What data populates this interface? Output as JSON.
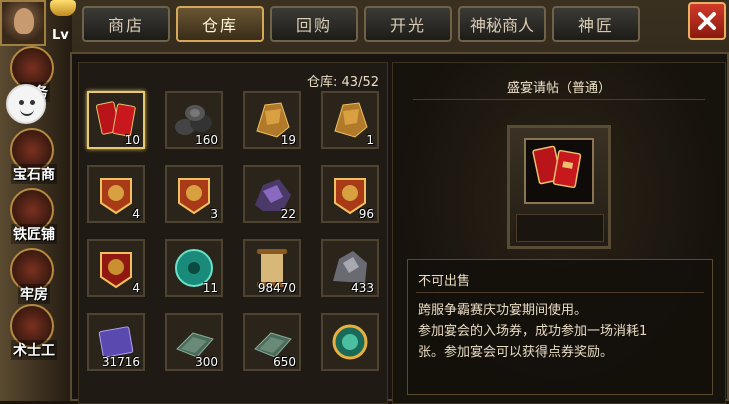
{
  "hud": {
    "level_label": "Lv",
    "side_buttons": [
      "任务",
      "宝石商",
      "铁匠铺",
      "牢房",
      "术士工"
    ]
  },
  "tabs": [
    {
      "label": "商店",
      "active": false
    },
    {
      "label": "仓库",
      "active": true
    },
    {
      "label": "回购",
      "active": false
    },
    {
      "label": "开光",
      "active": false
    },
    {
      "label": "神秘商人",
      "active": false
    },
    {
      "label": "神匠",
      "active": false
    }
  ],
  "inventory": {
    "capacity_label": "仓库: 43/52",
    "items": [
      {
        "icon": "red-envelope-icon",
        "qty": "10",
        "selected": true
      },
      {
        "icon": "charcoal-logs-icon",
        "qty": "160"
      },
      {
        "icon": "bronze-armor-icon",
        "qty": "19"
      },
      {
        "icon": "bronze-armor-icon",
        "qty": "1"
      },
      {
        "icon": "merchant-token-icon",
        "qty": "4"
      },
      {
        "icon": "merchant-token-icon",
        "qty": "3"
      },
      {
        "icon": "purple-ore-icon",
        "qty": "22"
      },
      {
        "icon": "merchant-token-icon",
        "qty": "96"
      },
      {
        "icon": "red-token-icon",
        "qty": "4"
      },
      {
        "icon": "jade-coin-icon",
        "qty": "11"
      },
      {
        "icon": "scroll-icon",
        "qty": "98470"
      },
      {
        "icon": "iron-ore-icon",
        "qty": "433"
      },
      {
        "icon": "purple-ticket-icon",
        "qty": "31716"
      },
      {
        "icon": "stone-slab-icon",
        "qty": "300"
      },
      {
        "icon": "stone-slab-icon",
        "qty": "650"
      },
      {
        "icon": "dragon-orb-icon",
        "qty": ""
      }
    ]
  },
  "detail": {
    "title": "盛宴请帖（普通）",
    "flag": "不可出售",
    "description_lines": [
      "跨服争霸赛庆功宴期间使用。",
      "参加宴会的入场券，成功参加一场消耗1",
      "张。参加宴会可以获得点券奖励。"
    ]
  },
  "colors": {
    "accent_gold": "#d4aa5a",
    "close_red": "#c0301e"
  }
}
